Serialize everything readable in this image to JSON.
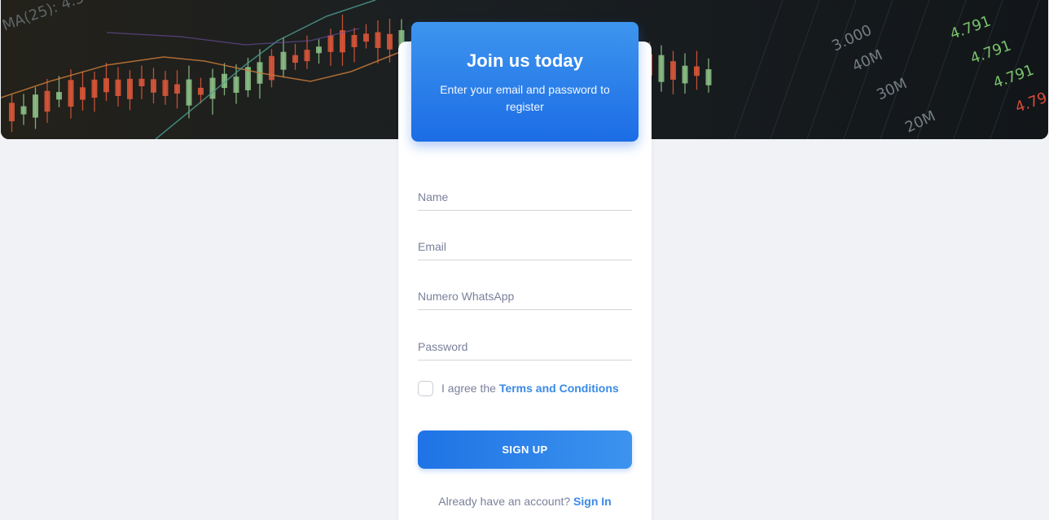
{
  "header": {
    "title": "Join us today",
    "subtitle": "Enter your email and password to register"
  },
  "form": {
    "name_placeholder": "Name",
    "email_placeholder": "Email",
    "whatsapp_placeholder": "Numero WhatsApp",
    "password_placeholder": "Password",
    "agree_text": "I agree the",
    "terms_link": "Terms and Conditions",
    "terms_checked": false,
    "submit_label": "SIGN UP"
  },
  "footer": {
    "prompt": "Already have an account?",
    "signin_link": "Sign In"
  },
  "hero": {
    "image": "trading-candlestick-chart",
    "labels": [
      "MA(25): 4.5",
      "3.000",
      "40M",
      "30M",
      "20M",
      "4.791",
      "4.791",
      "4.791",
      "4.79"
    ]
  },
  "colors": {
    "accent": "#1c6de5",
    "accent_light": "#3e95ee",
    "link": "#3a8ae5",
    "background": "#f0f2f5",
    "hero_background": "#141a1f",
    "candle_up": "#8fc68a",
    "candle_down": "#e0583a"
  }
}
